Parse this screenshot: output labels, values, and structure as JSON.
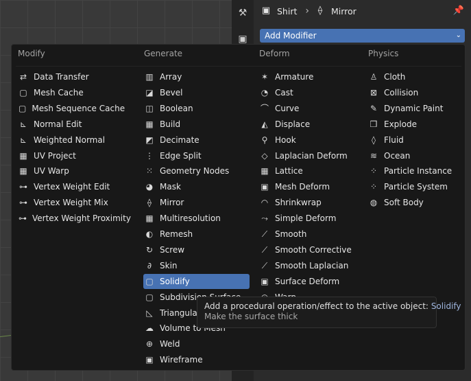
{
  "header": {
    "object_name": "Shirt",
    "modifier_name": "Mirror"
  },
  "add_modifier_label": "Add Modifier",
  "menu": {
    "columns": [
      {
        "title": "Modify",
        "items": [
          {
            "label": "Data Transfer",
            "icon": "data-transfer-icon"
          },
          {
            "label": "Mesh Cache",
            "icon": "mesh-cache-icon"
          },
          {
            "label": "Mesh Sequence Cache",
            "icon": "mesh-sequence-cache-icon"
          },
          {
            "label": "Normal Edit",
            "icon": "normal-edit-icon"
          },
          {
            "label": "Weighted Normal",
            "icon": "weighted-normal-icon"
          },
          {
            "label": "UV Project",
            "icon": "uv-project-icon"
          },
          {
            "label": "UV Warp",
            "icon": "uv-warp-icon"
          },
          {
            "label": "Vertex Weight Edit",
            "icon": "vertex-weight-icon"
          },
          {
            "label": "Vertex Weight Mix",
            "icon": "vertex-weight-icon"
          },
          {
            "label": "Vertex Weight Proximity",
            "icon": "vertex-weight-icon"
          }
        ]
      },
      {
        "title": "Generate",
        "items": [
          {
            "label": "Array",
            "icon": "array-icon"
          },
          {
            "label": "Bevel",
            "icon": "bevel-icon"
          },
          {
            "label": "Boolean",
            "icon": "boolean-icon"
          },
          {
            "label": "Build",
            "icon": "build-icon"
          },
          {
            "label": "Decimate",
            "icon": "decimate-icon"
          },
          {
            "label": "Edge Split",
            "icon": "edge-split-icon"
          },
          {
            "label": "Geometry Nodes",
            "icon": "geometry-nodes-icon"
          },
          {
            "label": "Mask",
            "icon": "mask-icon"
          },
          {
            "label": "Mirror",
            "icon": "mirror-icon"
          },
          {
            "label": "Multiresolution",
            "icon": "multiresolution-icon"
          },
          {
            "label": "Remesh",
            "icon": "remesh-icon"
          },
          {
            "label": "Screw",
            "icon": "screw-icon"
          },
          {
            "label": "Skin",
            "icon": "skin-icon"
          },
          {
            "label": "Solidify",
            "icon": "solidify-icon"
          },
          {
            "label": "Subdivision Surface",
            "icon": "subdivision-surface-icon"
          },
          {
            "label": "Triangulate",
            "icon": "triangulate-icon"
          },
          {
            "label": "Volume to Mesh",
            "icon": "volume-to-mesh-icon"
          },
          {
            "label": "Weld",
            "icon": "weld-icon"
          },
          {
            "label": "Wireframe",
            "icon": "wireframe-icon"
          }
        ]
      },
      {
        "title": "Deform",
        "items": [
          {
            "label": "Armature",
            "icon": "armature-icon"
          },
          {
            "label": "Cast",
            "icon": "cast-icon"
          },
          {
            "label": "Curve",
            "icon": "curve-icon"
          },
          {
            "label": "Displace",
            "icon": "displace-icon"
          },
          {
            "label": "Hook",
            "icon": "hook-icon"
          },
          {
            "label": "Laplacian Deform",
            "icon": "laplacian-deform-icon"
          },
          {
            "label": "Lattice",
            "icon": "lattice-icon"
          },
          {
            "label": "Mesh Deform",
            "icon": "mesh-deform-icon"
          },
          {
            "label": "Shrinkwrap",
            "icon": "shrinkwrap-icon"
          },
          {
            "label": "Simple Deform",
            "icon": "simple-deform-icon"
          },
          {
            "label": "Smooth",
            "icon": "smooth-icon"
          },
          {
            "label": "Smooth Corrective",
            "icon": "smooth-icon"
          },
          {
            "label": "Smooth Laplacian",
            "icon": "smooth-icon"
          },
          {
            "label": "Surface Deform",
            "icon": "surface-deform-icon"
          },
          {
            "label": "Warp",
            "icon": "warp-icon"
          }
        ]
      },
      {
        "title": "Physics",
        "items": [
          {
            "label": "Cloth",
            "icon": "cloth-icon"
          },
          {
            "label": "Collision",
            "icon": "collision-icon"
          },
          {
            "label": "Dynamic Paint",
            "icon": "dynamic-paint-icon"
          },
          {
            "label": "Explode",
            "icon": "explode-icon"
          },
          {
            "label": "Fluid",
            "icon": "fluid-icon"
          },
          {
            "label": "Ocean",
            "icon": "ocean-icon"
          },
          {
            "label": "Particle Instance",
            "icon": "particle-instance-icon"
          },
          {
            "label": "Particle System",
            "icon": "particle-system-icon"
          },
          {
            "label": "Soft Body",
            "icon": "soft-body-icon"
          }
        ]
      }
    ],
    "active_item": "Solidify"
  },
  "tooltip": {
    "line1_prefix": "Add a procedural operation/effect to the active object:",
    "line1_highlight": "Solidify",
    "line2": "Make the surface thick"
  },
  "colors": {
    "accent": "#4772b3",
    "menu_bg": "#181818",
    "tooltip_highlight": "#9fb6df"
  }
}
